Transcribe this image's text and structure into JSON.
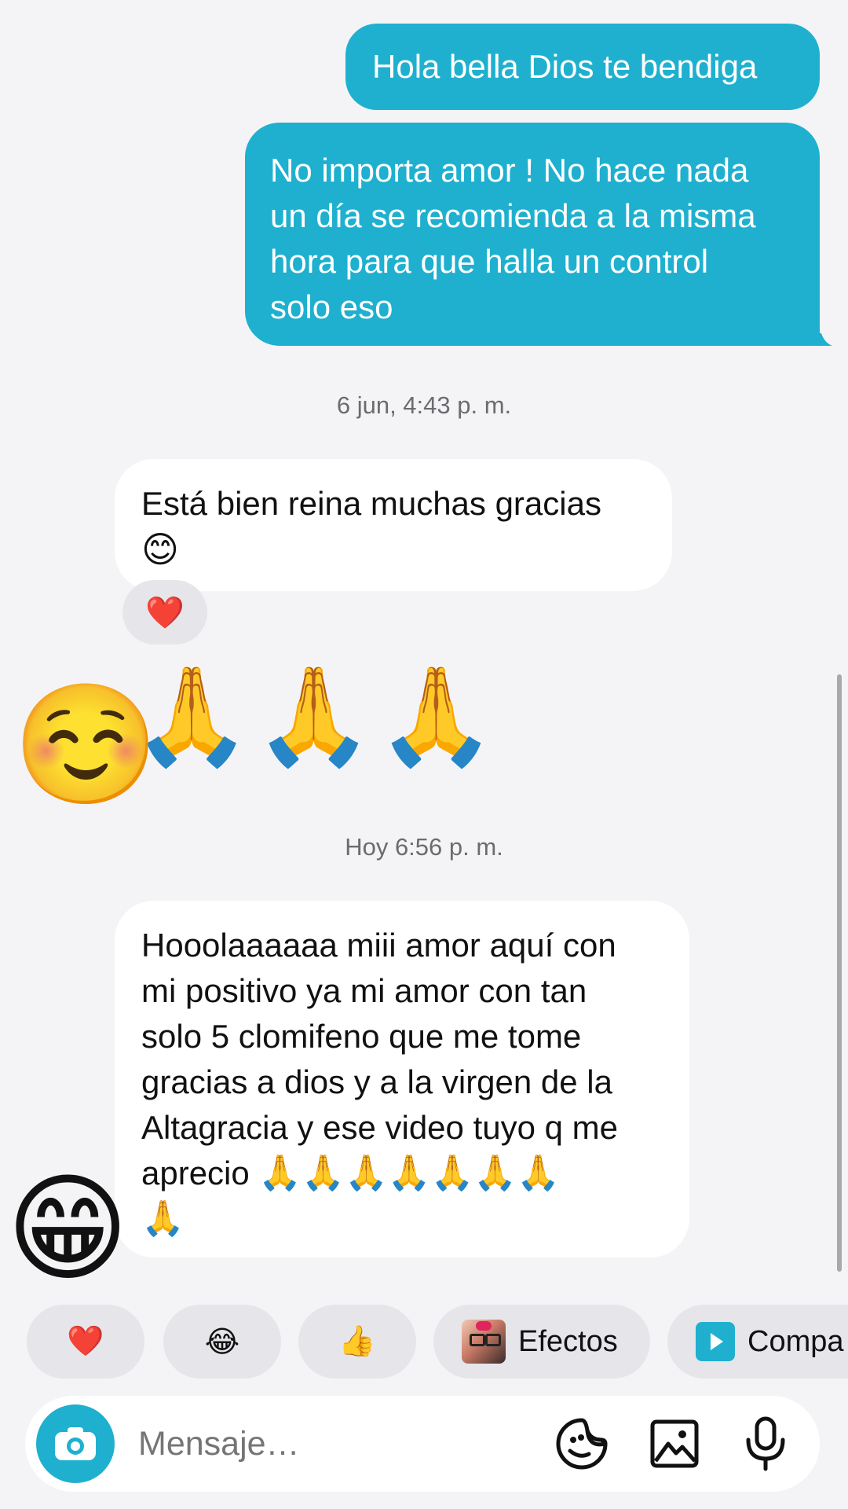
{
  "messages": [
    {
      "direction": "outgoing",
      "text": "Hola bella Dios te bendiga"
    },
    {
      "direction": "outgoing",
      "lines": [
        "No importa amor ! No hace nada",
        "un día se recomienda a la misma",
        "hora para que halla un control",
        "solo eso"
      ]
    },
    {
      "direction": "timestamp",
      "text": "6 jun, 4:43 p. m."
    },
    {
      "direction": "incoming",
      "line1": "Está bien reina muchas gracias",
      "emoji": "😊",
      "reaction": "❤️"
    },
    {
      "direction": "incoming",
      "emoji_only": "🙏🙏🙏",
      "avatar_emoji": "☺️"
    },
    {
      "direction": "timestamp",
      "text": "Hoy 6:56 p. m."
    },
    {
      "direction": "incoming",
      "lines": [
        "Hooolaaaaaa miii amor aquí con",
        "mi positivo ya mi amor con tan",
        "solo 5 clomifeno que me tome",
        "gracias a dios y a la virgen de la",
        "Altagracia y ese video tuyo q me"
      ],
      "last_line_text": "aprecio ",
      "last_line_emoji": "🙏🙏🙏🙏🙏🙏🙏",
      "extra_emoji": "🙏",
      "avatar_emoji": "😁"
    }
  ],
  "quick_reactions": [
    {
      "emoji": "❤️"
    },
    {
      "emoji": "😂"
    },
    {
      "emoji": "👍"
    },
    {
      "label": "Efectos",
      "icon": "effects-avatar-icon"
    },
    {
      "label": "Compa",
      "icon": "share-play-icon"
    }
  ],
  "composer": {
    "placeholder": "Mensaje…",
    "icons": [
      "camera-icon",
      "sticker-icon",
      "gallery-icon",
      "microphone-icon"
    ]
  },
  "colors": {
    "outgoing_bubble": "#1fb0cf",
    "incoming_bubble": "#ffffff",
    "background": "#f4f4f6",
    "accent": "#1fb0cf"
  }
}
